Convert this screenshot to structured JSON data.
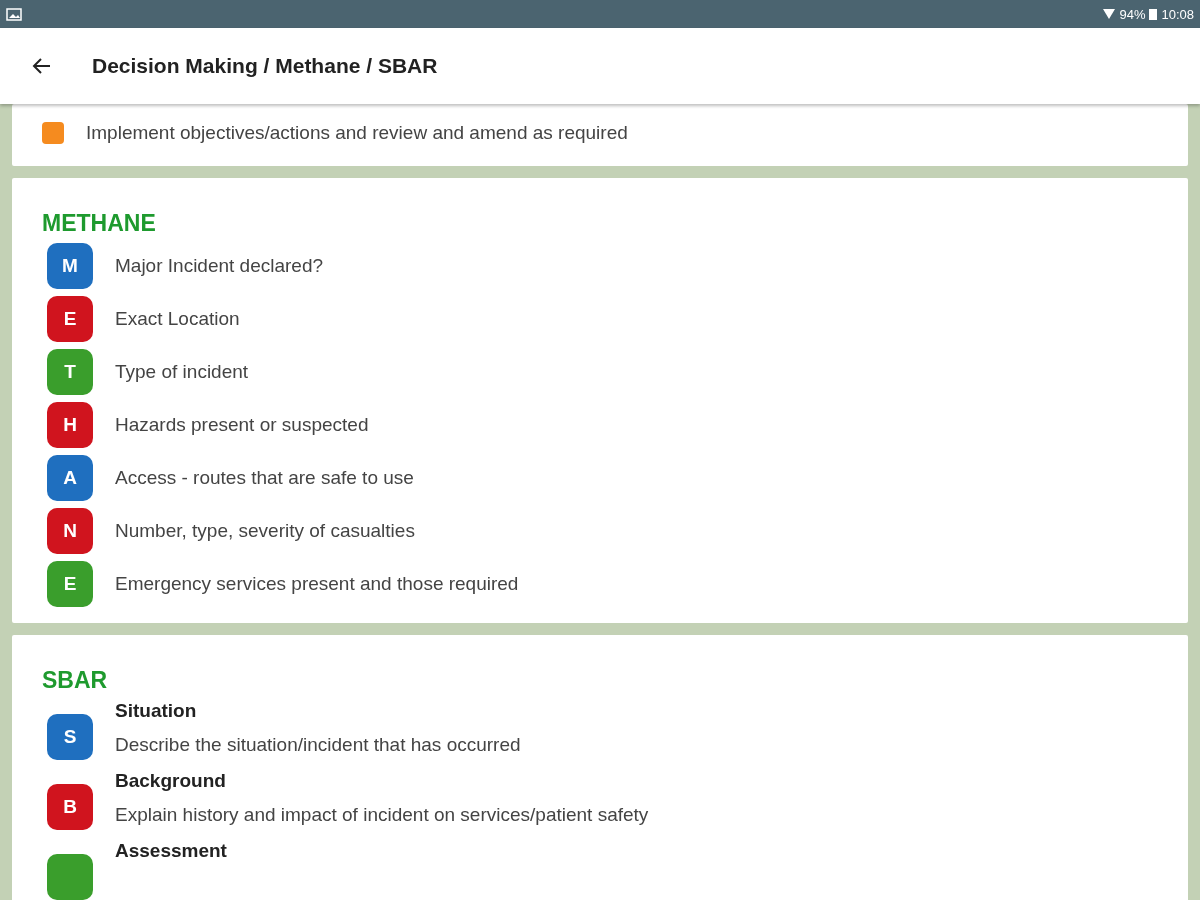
{
  "status_bar": {
    "battery": "94%",
    "time": "10:08"
  },
  "app_bar": {
    "title": "Decision Making / Methane / SBAR"
  },
  "top_card": {
    "items": [
      {
        "text": "Implement objectives/actions and review and amend as required",
        "color": "#f58b1f"
      }
    ]
  },
  "sections": [
    {
      "title": "METHANE",
      "kind": "simple",
      "items": [
        {
          "letter": "M",
          "text": "Major Incident declared?",
          "color": "#1f6fbf"
        },
        {
          "letter": "E",
          "text": "Exact Location",
          "color": "#d0141e"
        },
        {
          "letter": "T",
          "text": "Type of incident",
          "color": "#3a9e2c"
        },
        {
          "letter": "H",
          "text": "Hazards present or suspected",
          "color": "#d0141e"
        },
        {
          "letter": "A",
          "text": "Access - routes that are safe to use",
          "color": "#1f6fbf"
        },
        {
          "letter": "N",
          "text": "Number, type, severity of casualties",
          "color": "#d0141e"
        },
        {
          "letter": "E",
          "text": "Emergency services present and those required",
          "color": "#3a9e2c"
        }
      ]
    },
    {
      "title": "SBAR",
      "kind": "detailed",
      "items": [
        {
          "letter": "S",
          "heading": "Situation",
          "text": "Describe the situation/incident that has occurred",
          "color": "#1f6fbf"
        },
        {
          "letter": "B",
          "heading": "Background",
          "text": "Explain history and impact of incident on services/patient safety",
          "color": "#d0141e"
        },
        {
          "heading": "Assessment",
          "color": "#3a9e2c"
        }
      ]
    }
  ]
}
